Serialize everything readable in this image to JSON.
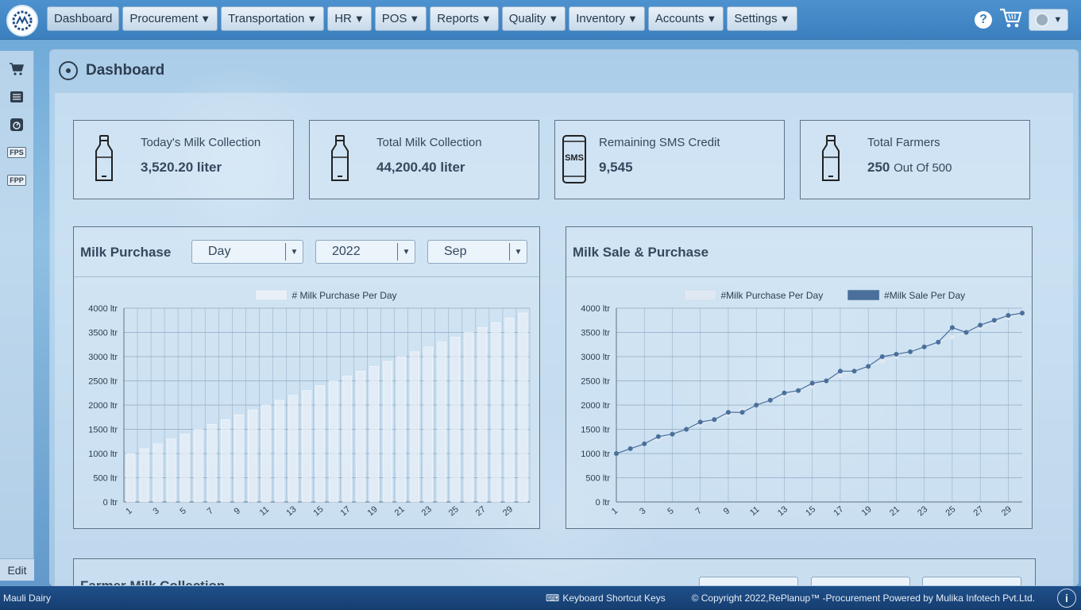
{
  "nav": {
    "items": [
      {
        "label": "Dashboard",
        "caret": ""
      },
      {
        "label": "Procurement",
        "caret": "▼"
      },
      {
        "label": "Transportation",
        "caret": "▼"
      },
      {
        "label": "HR",
        "caret": "▼"
      },
      {
        "label": "POS",
        "caret": "▼"
      },
      {
        "label": "Reports",
        "caret": "▼"
      },
      {
        "label": "Quality",
        "caret": "▼"
      },
      {
        "label": "Inventory",
        "caret": "▼"
      },
      {
        "label": "Accounts",
        "caret": "▼"
      },
      {
        "label": "Settings",
        "caret": "▼"
      }
    ],
    "help": "?",
    "user_caret": "▼"
  },
  "sidebar": {
    "tags": [
      "FPS",
      "FPP"
    ],
    "edit_label": "Edit"
  },
  "page": {
    "title": "Dashboard"
  },
  "cards": [
    {
      "label": "Today's Milk Collection",
      "value": "3,520.20 liter",
      "sub": "",
      "icon": "milk-bottle-icon"
    },
    {
      "label": "Total Milk Collection",
      "value": "44,200.40 liter",
      "sub": "",
      "icon": "milk-bottle-icon"
    },
    {
      "label": "Remaining SMS Credit",
      "value": "9,545",
      "sub": "",
      "icon": "sms-phone-icon",
      "icon_text": "SMS"
    },
    {
      "label": "Total Farmers",
      "value": "250",
      "sub": "Out Of 500",
      "icon": "milk-bottle-icon"
    }
  ],
  "milk_purchase_panel": {
    "title": "Milk Purchase",
    "period_select": "Day",
    "year_select": "2022",
    "month_select": "Sep"
  },
  "sale_purchase_panel": {
    "title": "Milk Sale & Purchase"
  },
  "bottom_panel": {
    "title": "Farmer Milk Collection"
  },
  "footer": {
    "company": "Mauli Dairy",
    "shortcut_label": "Keyboard Shortcut Keys",
    "copyright": "© Copyright 2022,RePlanup™ -Procurement Powered by Mulika Infotech Pvt.Ltd.",
    "info": "i"
  },
  "chart_data": [
    {
      "type": "bar",
      "legend": [
        "# Milk Purchase Per Day"
      ],
      "legend_position": "top-center",
      "ylim": [
        0,
        4000
      ],
      "yticks": [
        "0 ltr",
        "500 ltr",
        "1000 ltr",
        "1500 ltr",
        "2000 ltr",
        "2500 ltr",
        "3000 ltr",
        "3500 ltr",
        "4000 ltr"
      ],
      "xticks": [
        "1",
        "3",
        "5",
        "7",
        "9",
        "11",
        "13",
        "15",
        "17",
        "19",
        "21",
        "23",
        "25",
        "27",
        "29"
      ],
      "grid": true,
      "categories": [
        1,
        2,
        3,
        4,
        5,
        6,
        7,
        8,
        9,
        10,
        11,
        12,
        13,
        14,
        15,
        16,
        17,
        18,
        19,
        20,
        21,
        22,
        23,
        24,
        25,
        26,
        27,
        28,
        29,
        30
      ],
      "series": [
        {
          "name": "# Milk Purchase Per Day",
          "color": "#e8eff7",
          "values": [
            1000,
            1100,
            1200,
            1300,
            1400,
            1500,
            1600,
            1700,
            1800,
            1900,
            2000,
            2100,
            2200,
            2300,
            2400,
            2500,
            2600,
            2700,
            2800,
            2900,
            3000,
            3100,
            3200,
            3300,
            3400,
            3500,
            3600,
            3700,
            3800,
            3900
          ]
        }
      ]
    },
    {
      "type": "line",
      "legend": [
        "#Milk Purchase Per Day",
        "#Milk Sale Per Day"
      ],
      "legend_position": "top-center",
      "ylim": [
        0,
        4000
      ],
      "yticks": [
        "0 ltr",
        "500 ltr",
        "1000 ltr",
        "1500 ltr",
        "2000 ltr",
        "2500 ltr",
        "3000 ltr",
        "3500 ltr",
        "4000 ltr"
      ],
      "xticks": [
        "1",
        "3",
        "5",
        "7",
        "9",
        "11",
        "13",
        "15",
        "17",
        "19",
        "21",
        "23",
        "25",
        "27",
        "29"
      ],
      "grid": true,
      "x": [
        1,
        2,
        3,
        4,
        5,
        6,
        7,
        8,
        9,
        10,
        11,
        12,
        13,
        14,
        15,
        16,
        17,
        18,
        19,
        20,
        21,
        22,
        23,
        24,
        25,
        26,
        27,
        28,
        29,
        30
      ],
      "series": [
        {
          "name": "#Milk Purchase Per Day",
          "color": "#dfe8f2",
          "values": [
            1000,
            1100,
            1200,
            1300,
            1400,
            1500,
            1600,
            1700,
            1800,
            1900,
            2000,
            2100,
            2200,
            2300,
            2400,
            2500,
            2600,
            2700,
            2800,
            2900,
            3000,
            3100,
            3200,
            3300,
            3400,
            3500,
            3600,
            3700,
            3800,
            3900
          ]
        },
        {
          "name": "#Milk Sale Per Day",
          "color": "#4a6f9a",
          "values": [
            1000,
            1100,
            1200,
            1350,
            1400,
            1500,
            1650,
            1700,
            1850,
            1850,
            2000,
            2100,
            2250,
            2300,
            2450,
            2500,
            2700,
            2700,
            2800,
            3000,
            3050,
            3100,
            3200,
            3300,
            3600,
            3500,
            3650,
            3750,
            3850,
            3900
          ]
        }
      ]
    }
  ]
}
